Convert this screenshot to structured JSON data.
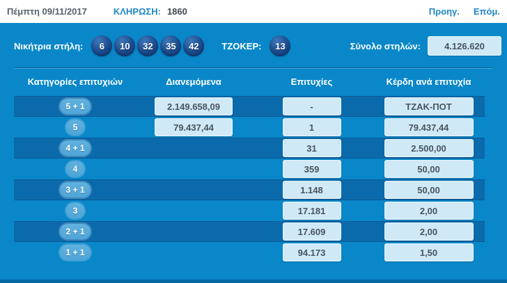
{
  "topbar": {
    "date": "Πέμπτη 09/11/2017",
    "draw_label": "ΚΛΗΡΩΣΗ:",
    "draw_number": "1860",
    "prev_label": "Προηγ.",
    "next_label": "Επόμ."
  },
  "panel": {
    "winning_label": "Νικήτρια στήλη:",
    "numbers": [
      "6",
      "10",
      "32",
      "35",
      "42"
    ],
    "joker_label": "ΤΖΟΚΕΡ:",
    "joker_number": "13",
    "total_label": "Σύνολο στηλών:",
    "total_value": "4.126.620"
  },
  "table": {
    "headers": {
      "category": "Κατηγορίες επιτυχιών",
      "distributed": "Διανεμόμενα",
      "hits": "Επιτυχίες",
      "prize": "Κέρδη ανά επιτυχία"
    },
    "rows": [
      {
        "category": "5 + 1",
        "distributed": "2.149.658,09",
        "hits": "-",
        "prize": "ΤΖΑΚ-ΠΟΤ"
      },
      {
        "category": "5",
        "distributed": "79.437,44",
        "hits": "1",
        "prize": "79.437,44"
      },
      {
        "category": "4 + 1",
        "hits": "31",
        "prize": "2.500,00"
      },
      {
        "category": "4",
        "hits": "359",
        "prize": "50,00"
      },
      {
        "category": "3 + 1",
        "hits": "1.148",
        "prize": "50,00"
      },
      {
        "category": "3",
        "hits": "17.181",
        "prize": "2,00"
      },
      {
        "category": "2 + 1",
        "hits": "17.609",
        "prize": "2,00"
      },
      {
        "category": "1 + 1",
        "hits": "94.173",
        "prize": "1,50"
      }
    ]
  },
  "colors": {
    "panel_blue": "#0987c9",
    "stripe_blue": "#0b6aab",
    "ball_navy": "#123f7c",
    "value_box": "#cfe9f7",
    "link_blue": "#1e87c5"
  }
}
